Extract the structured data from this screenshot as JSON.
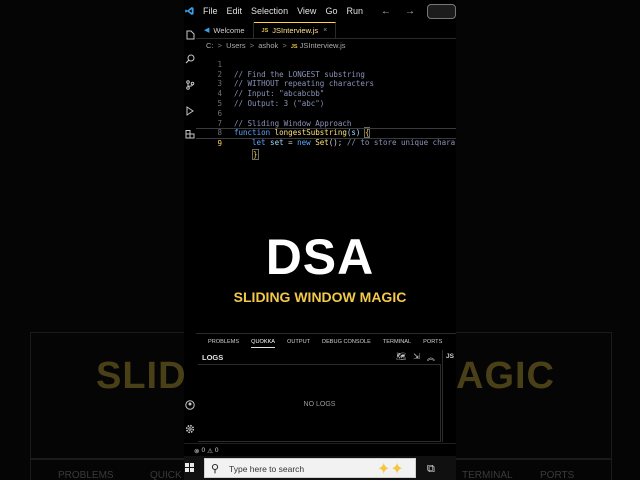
{
  "menu": {
    "items": [
      "File",
      "Edit",
      "Selection",
      "View",
      "Go",
      "Run"
    ],
    "nav_back": "←",
    "nav_forward": "→"
  },
  "tabs": [
    {
      "label": "Welcome",
      "icon": "vscode-icon",
      "active": false
    },
    {
      "label": "JSInterview.js",
      "icon": "js-file-icon",
      "active": true,
      "close": "×"
    }
  ],
  "breadcrumb": {
    "parts": [
      "C:",
      "Users",
      "ashok"
    ],
    "file_badge": "JS",
    "file": "JSInterview.js",
    "separator": ">"
  },
  "code": {
    "line_numbers": [
      "1",
      "2",
      "3",
      "4",
      "5",
      "6",
      "7",
      "8",
      "9"
    ],
    "lines": {
      "l1": "// Find the LONGEST substring",
      "l2": "// WITHOUT repeating characters",
      "l3": "// Input: \"abcabcbb\"",
      "l4": "// Output: 3 (\"abc\")",
      "l6": "// Sliding Window Approach",
      "l7_kw": "function",
      "l7_fn": "longestSubstring",
      "l7_param": "(s) ",
      "l7_brace": "{",
      "l8_kw": "let",
      "l8_var": " set ",
      "l8_op": "= ",
      "l8_kw2": "new",
      "l8_cls": " Set",
      "l8_rest": "(); ",
      "l8_cm": "// to store unique charact",
      "l9_brace": "}"
    }
  },
  "overlay": {
    "title": "DSA",
    "subtitle": "SLIDING WINDOW MAGIC"
  },
  "background_text": {
    "left": "SLIDI",
    "right": "AGIC",
    "panel_left": "PROBLEMS",
    "panel_mid": "QUICK",
    "panel_right": "TERMINAL",
    "panel_far": "PORTS"
  },
  "panel": {
    "tabs": [
      "PROBLEMS",
      "QUOKKA",
      "OUTPUT",
      "DEBUG CONSOLE",
      "TERMINAL",
      "PORTS"
    ],
    "active_tab": "QUOKKA",
    "logs_title": "LOGS",
    "side_label": "JS",
    "empty_text": "NO LOGS"
  },
  "status": {
    "errors": "0",
    "warnings": "0"
  },
  "taskbar": {
    "search_placeholder": "Type here to search"
  },
  "colors": {
    "accent_yellow": "#f2c94c",
    "keyword_blue": "#5aa6ff",
    "comment": "#8b93b8",
    "function": "#ffe27a"
  }
}
